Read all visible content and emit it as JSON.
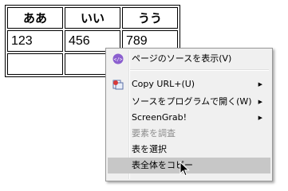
{
  "table": {
    "headers": [
      "ああ",
      "いい",
      "うう"
    ],
    "rows": [
      [
        "123",
        "456",
        "789"
      ],
      [
        "",
        "",
        ""
      ]
    ]
  },
  "context_menu": {
    "items": [
      {
        "label": "ページのソースを表示(V)",
        "icon": "page-source-icon",
        "disabled": false,
        "submenu": false
      },
      {
        "label": "Copy URL+(U)",
        "icon": "copy-url-plus-icon",
        "disabled": false,
        "submenu": true
      },
      {
        "label": "ソースをプログラムで開く(W)",
        "icon": "",
        "disabled": false,
        "submenu": true
      },
      {
        "label": "ScreenGrab!",
        "icon": "",
        "disabled": false,
        "submenu": true
      },
      {
        "label": "要素を調査",
        "icon": "",
        "disabled": true,
        "submenu": false
      },
      {
        "label": "表を選択",
        "icon": "",
        "disabled": false,
        "submenu": false
      },
      {
        "label": "表全体をコピー",
        "icon": "",
        "disabled": false,
        "submenu": false,
        "highlighted": true
      }
    ]
  },
  "colors": {
    "menu_background": "#f0f0f0",
    "highlight": "#c7c7c7",
    "disabled_text": "#8d8d8d",
    "source_icon": "#8b5fcf"
  },
  "icons": {
    "submenu_arrow": "▶",
    "cursor": "mouse-pointer-icon"
  }
}
